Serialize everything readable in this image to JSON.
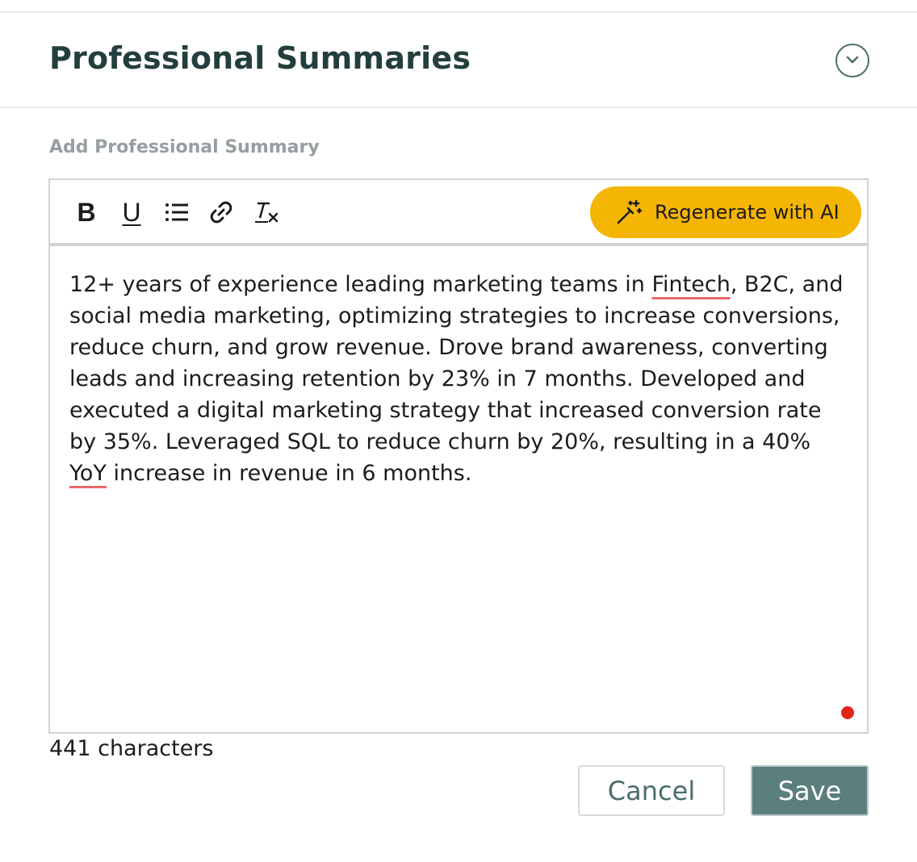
{
  "header": {
    "title": "Professional Summaries",
    "collapse_icon": "chevron-down-circle-icon"
  },
  "field": {
    "label": "Add Professional Summary"
  },
  "toolbar": {
    "buttons": [
      {
        "name": "bold",
        "glyph": "B",
        "icon": "bold-icon"
      },
      {
        "name": "underline",
        "glyph": "U",
        "icon": "underline-icon"
      },
      {
        "name": "bullet-list",
        "icon": "list-icon"
      },
      {
        "name": "link",
        "icon": "link-icon"
      },
      {
        "name": "clear-format",
        "icon": "clear-format-icon"
      }
    ],
    "ai_button": {
      "label": "Regenerate with AI",
      "icon": "magic-wand-icon",
      "color": "#f5b505"
    }
  },
  "editor": {
    "segments": [
      {
        "text": "12+ years of experience leading marketing teams in "
      },
      {
        "text": "Fintech",
        "spellcheck_flag": true
      },
      {
        "text": ", B2C, and social media marketing, optimizing strategies to increase conversions, reduce churn, and grow revenue. Drove brand awareness, converting leads and increasing retention by 23% in 7 months. Developed and executed a digital marketing strategy that increased conversion rate by 35%. Leveraged SQL to reduce churn by 20%, resulting in a 40% "
      },
      {
        "text": "YoY",
        "spellcheck_flag": true
      },
      {
        "text": " increase in revenue in 6 months."
      }
    ],
    "status_dot_color": "#e3221a"
  },
  "footer": {
    "char_count": "441 characters",
    "cancel_label": "Cancel",
    "save_label": "Save"
  },
  "colors": {
    "title": "#233f3d",
    "accent": "#5b7f7d",
    "spellcheck_underline": "#e76a6c"
  }
}
